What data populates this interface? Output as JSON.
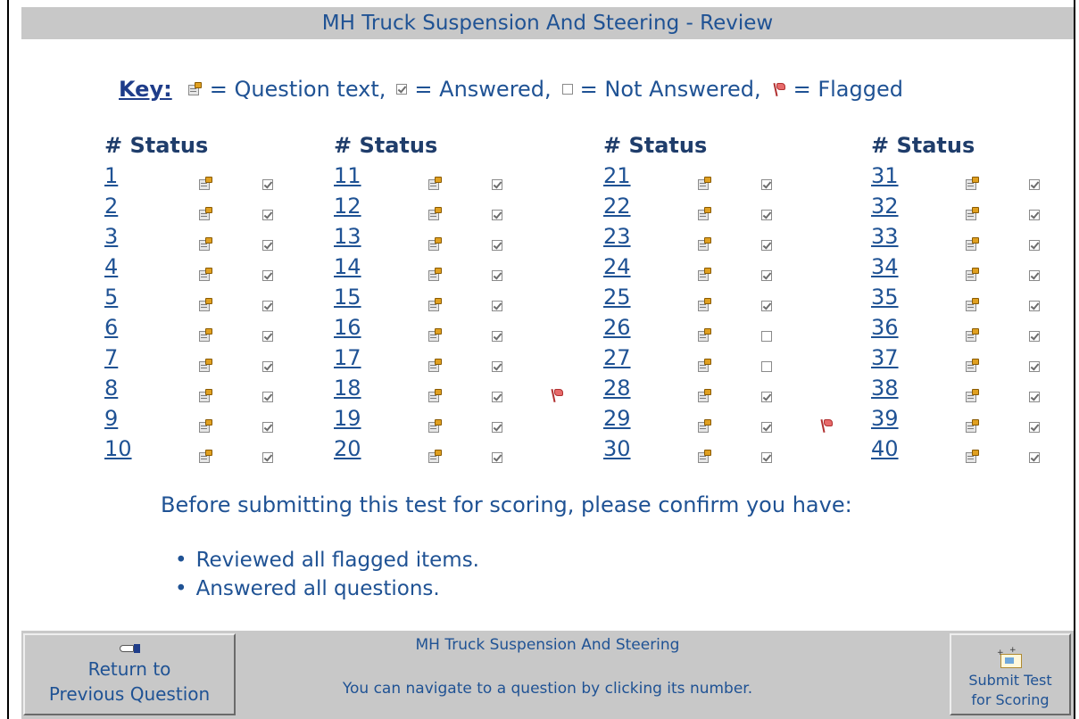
{
  "window": {
    "title": "MH Truck Suspension And Steering - Review"
  },
  "key": {
    "label": "Key:",
    "question_text": "= Question text,",
    "answered": "= Answered,",
    "not_answered": "= Not Answered,",
    "flagged": "= Flagged",
    "icons": [
      "question-text-icon",
      "answered-checkbox-icon",
      "unanswered-checkbox-icon",
      "flag-icon"
    ]
  },
  "grid": {
    "header": "# Status",
    "columns": [
      [
        {
          "num": "1",
          "answered": true,
          "flagged": false
        },
        {
          "num": "2",
          "answered": true,
          "flagged": false
        },
        {
          "num": "3",
          "answered": true,
          "flagged": false
        },
        {
          "num": "4",
          "answered": true,
          "flagged": false
        },
        {
          "num": "5",
          "answered": true,
          "flagged": false
        },
        {
          "num": "6",
          "answered": true,
          "flagged": false
        },
        {
          "num": "7",
          "answered": true,
          "flagged": false
        },
        {
          "num": "8",
          "answered": true,
          "flagged": false
        },
        {
          "num": "9",
          "answered": true,
          "flagged": false
        },
        {
          "num": "10",
          "answered": true,
          "flagged": false
        }
      ],
      [
        {
          "num": "11",
          "answered": true,
          "flagged": false
        },
        {
          "num": "12",
          "answered": true,
          "flagged": false
        },
        {
          "num": "13",
          "answered": true,
          "flagged": false
        },
        {
          "num": "14",
          "answered": true,
          "flagged": false
        },
        {
          "num": "15",
          "answered": true,
          "flagged": false
        },
        {
          "num": "16",
          "answered": true,
          "flagged": false
        },
        {
          "num": "17",
          "answered": true,
          "flagged": false
        },
        {
          "num": "18",
          "answered": true,
          "flagged": true
        },
        {
          "num": "19",
          "answered": true,
          "flagged": false
        },
        {
          "num": "20",
          "answered": true,
          "flagged": false
        }
      ],
      [
        {
          "num": "21",
          "answered": true,
          "flagged": false
        },
        {
          "num": "22",
          "answered": true,
          "flagged": false
        },
        {
          "num": "23",
          "answered": true,
          "flagged": false
        },
        {
          "num": "24",
          "answered": true,
          "flagged": false
        },
        {
          "num": "25",
          "answered": true,
          "flagged": false
        },
        {
          "num": "26",
          "answered": false,
          "flagged": false
        },
        {
          "num": "27",
          "answered": false,
          "flagged": false
        },
        {
          "num": "28",
          "answered": true,
          "flagged": false
        },
        {
          "num": "29",
          "answered": true,
          "flagged": true
        },
        {
          "num": "30",
          "answered": true,
          "flagged": false
        }
      ],
      [
        {
          "num": "31",
          "answered": true,
          "flagged": false
        },
        {
          "num": "32",
          "answered": true,
          "flagged": false
        },
        {
          "num": "33",
          "answered": true,
          "flagged": false
        },
        {
          "num": "34",
          "answered": true,
          "flagged": false
        },
        {
          "num": "35",
          "answered": true,
          "flagged": false
        },
        {
          "num": "36",
          "answered": true,
          "flagged": false
        },
        {
          "num": "37",
          "answered": true,
          "flagged": false
        },
        {
          "num": "38",
          "answered": true,
          "flagged": false
        },
        {
          "num": "39",
          "answered": true,
          "flagged": false
        },
        {
          "num": "40",
          "answered": true,
          "flagged": false
        }
      ]
    ]
  },
  "confirm": {
    "heading": "Before submitting this test for scoring, please confirm you have:",
    "items": [
      "Reviewed all flagged items.",
      "Answered all questions."
    ]
  },
  "footer": {
    "return_button_line1": "Return to",
    "return_button_line2": "Previous Question",
    "return_icon": "pointing-hand-icon",
    "title": "MH Truck Suspension And Steering",
    "hint": "You can navigate to a question by clicking its number.",
    "submit_button_line1": "Submit Test",
    "submit_button_line2": "for Scoring",
    "submit_icon": "envelope-submit-icon"
  },
  "colors": {
    "text_blue": "#1f5294",
    "bar_gray": "#c8c8c8",
    "flag_red": "#e76a6a"
  }
}
